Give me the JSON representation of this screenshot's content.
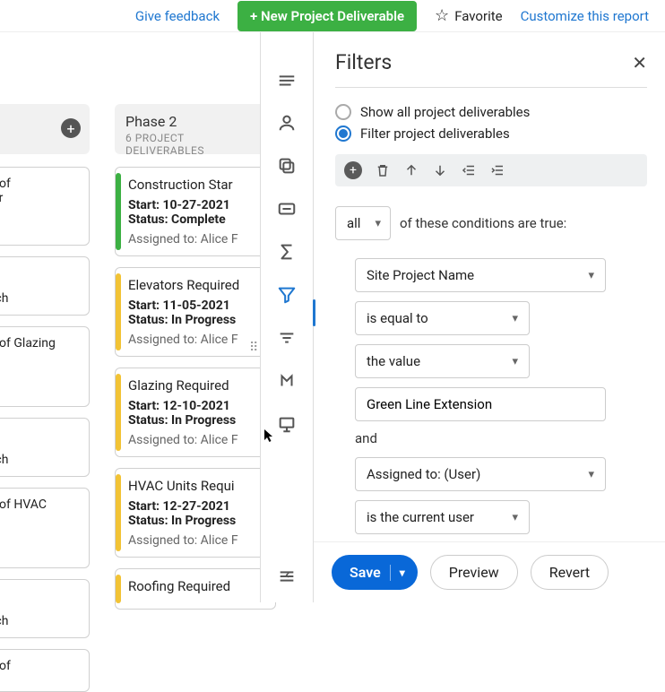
{
  "topbar": {
    "feedback": "Give feedback",
    "new_deliverable": "+ New Project Deliverable",
    "favorite": "Favorite",
    "customize": "Customize this report"
  },
  "board": {
    "col0": {
      "add_icon": "plus-circle-icon",
      "cards": [
        {
          "frag1": "t of",
          "frag2": "ar"
        },
        {
          "frag1": "ich"
        },
        {
          "frag1": "t of Glazing"
        },
        {
          "frag1": "ich"
        },
        {
          "frag1": "t of HVAC"
        },
        {
          "frag1": "ich"
        },
        {
          "frag1": "t of"
        }
      ]
    },
    "col1": {
      "title": "Phase 2",
      "subtitle": "6 PROJECT DELIVERABLES",
      "cards": [
        {
          "title": "Construction Star",
          "start": "Start: 10-27-2021",
          "status": "Status: Complete",
          "assigned": "Assigned to: Alice F",
          "color": "green"
        },
        {
          "title": "Elevators Required",
          "start": "Start: 11-05-2021",
          "status": "Status: In Progress",
          "assigned": "Assigned to: Alice F",
          "color": "yellow"
        },
        {
          "title": "Glazing Required",
          "start": "Start: 12-10-2021",
          "status": "Status: In Progress",
          "assigned": "Assigned to: Alice F",
          "color": "yellow"
        },
        {
          "title": "HVAC Units Requi",
          "start": "Start: 12-27-2021",
          "status": "Status: In Progress",
          "assigned": "Assigned to: Alice F",
          "color": "yellow"
        },
        {
          "title": "Roofing Required",
          "start": "",
          "status": "",
          "assigned": "",
          "color": "yellow"
        }
      ]
    }
  },
  "rail": {
    "icons": [
      "list-icon",
      "user-icon",
      "copy-icon",
      "card-icon",
      "sigma-icon",
      "funnel-icon",
      "lines-icon",
      "pivot-icon",
      "display-icon"
    ],
    "active_index": 5,
    "collapse_icon": "collapse-icon"
  },
  "panel": {
    "title": "Filters",
    "radio1": "Show all project deliverables",
    "radio2": "Filter project deliverables",
    "radio_selected": 2,
    "toolbar": [
      "add-icon",
      "trash-icon",
      "arrow-up-icon",
      "arrow-down-icon",
      "outdent-icon",
      "indent-icon"
    ],
    "match_selector": "all",
    "match_text": "of these conditions are true:",
    "conditions": [
      {
        "field": "Site Project Name",
        "operator": "is equal to",
        "value_type": "the value",
        "value": "Green Line Extension"
      },
      {
        "field": "Assigned to: (User)",
        "operator": "is the current user"
      }
    ],
    "and_label": "and",
    "footer": {
      "save": "Save",
      "preview": "Preview",
      "revert": "Revert"
    }
  }
}
